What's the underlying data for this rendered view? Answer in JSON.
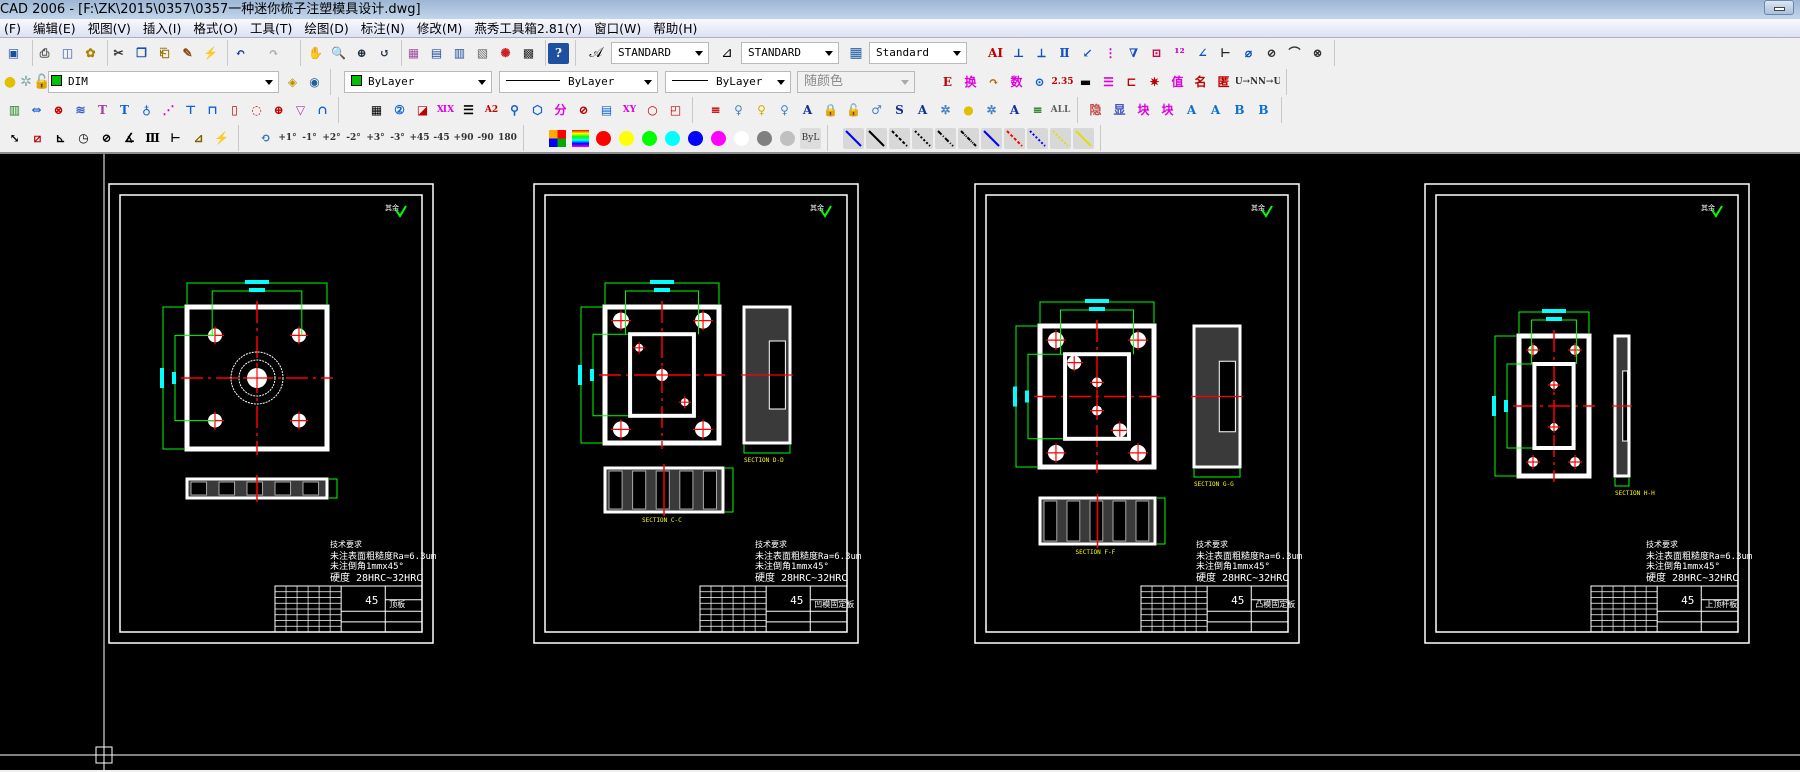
{
  "window": {
    "title": "CAD 2006 - [F:\\ZK\\2015\\0357\\0357一种迷你梳子注塑模具设计.dwg]"
  },
  "menu": [
    "(F)",
    "编辑(E)",
    "视图(V)",
    "插入(I)",
    "格式(O)",
    "工具(T)",
    "绘图(D)",
    "标注(N)",
    "修改(M)",
    "燕秀工具箱2.81(Y)",
    "窗口(W)",
    "帮助(H)"
  ],
  "toolbar_row1": {
    "groups": [
      [
        {
          "name": "save",
          "g": "▣",
          "c": "#1c4fa0"
        }
      ],
      [
        {
          "name": "print",
          "g": "⎙",
          "c": "#555"
        },
        {
          "name": "plot-preview",
          "g": "◫",
          "c": "#3060a0"
        },
        {
          "name": "publish",
          "g": "✿",
          "c": "#b08000"
        }
      ],
      [
        {
          "name": "cut",
          "g": "✂",
          "c": "#333"
        },
        {
          "name": "copy",
          "g": "❐",
          "c": "#2050a0"
        },
        {
          "name": "paste",
          "g": "⎗",
          "c": "#a07000"
        },
        {
          "name": "match-properties",
          "g": "✎",
          "c": "#8b4513"
        },
        {
          "name": "block-editor",
          "g": "⚡",
          "c": "#d05000"
        }
      ],
      [
        {
          "name": "undo",
          "g": "↶",
          "c": "#1a3a8a"
        },
        {
          "name": "redo",
          "g": "↷",
          "c": "#aaa"
        }
      ],
      [
        {
          "name": "pan",
          "g": "✋",
          "c": "#b07050"
        },
        {
          "name": "zoom-realtime",
          "g": "🔍",
          "c": "#234"
        },
        {
          "name": "zoom-window",
          "g": "⊕",
          "c": "#234"
        },
        {
          "name": "zoom-previous",
          "g": "↺",
          "c": "#234"
        }
      ],
      [
        {
          "name": "properties",
          "g": "▦",
          "c": "#a050a0"
        },
        {
          "name": "design-center",
          "g": "▤",
          "c": "#2050a0"
        },
        {
          "name": "tool-palettes",
          "g": "▥",
          "c": "#2050a0"
        },
        {
          "name": "sheet-set",
          "g": "▧",
          "c": "#666"
        },
        {
          "name": "markup",
          "g": "✺",
          "c": "#d02020"
        },
        {
          "name": "quickcalc",
          "g": "▩",
          "c": "#222"
        }
      ],
      [
        {
          "name": "help",
          "g": "?",
          "c": "#fff",
          "bg": "#1f4fa0"
        }
      ],
      [
        {
          "name": "dim-text",
          "g": "AI",
          "c": "#c00000"
        },
        {
          "name": "dim-linear",
          "g": "⊥",
          "c": "#1050c0"
        },
        {
          "name": "dim-ordinate",
          "g": "⟂",
          "c": "#1050c0"
        },
        {
          "name": "dim-baseline",
          "g": "Ⅱ",
          "c": "#1050c0"
        },
        {
          "name": "dim-leader",
          "g": "↙",
          "c": "#1050c0"
        },
        {
          "name": "dim-numbering",
          "g": "⋮",
          "c": "#d000d0"
        },
        {
          "name": "dim-tolerance",
          "g": "∇",
          "c": "#1050c0"
        },
        {
          "name": "dim-coordinate",
          "g": "⊡",
          "c": "#d00050"
        },
        {
          "name": "dim-sequence",
          "g": "¹²",
          "c": "#d000d0"
        },
        {
          "name": "dim-angle",
          "g": "∠",
          "c": "#1050c0"
        },
        {
          "name": "dim-break",
          "g": "⊢",
          "c": "#222"
        },
        {
          "name": "dim-diameter",
          "g": "⌀",
          "c": "#1050c0"
        },
        {
          "name": "dim-radius",
          "g": "⊘",
          "c": "#333"
        },
        {
          "name": "dim-arc",
          "g": "⌒",
          "c": "#333"
        },
        {
          "name": "dim-edit",
          "g": "⊗",
          "c": "#333"
        }
      ]
    ],
    "text_style": "STANDARD",
    "dim_style": "STANDARD",
    "table_style": "Standard"
  },
  "toolbar_row2": {
    "layer": "DIM",
    "color": "ByLayer",
    "linetype": "ByLayer",
    "lineweight": "ByLayer",
    "plot_style": "随颜色",
    "layer_icons": [
      {
        "name": "layer-previous",
        "g": "◈",
        "c": "#c09000"
      },
      {
        "name": "layer-make-current",
        "g": "◉",
        "c": "#2060a0"
      }
    ],
    "icons": [
      {
        "name": "replace-text",
        "g": "E",
        "c": "#c00000"
      },
      {
        "name": "convert",
        "g": "换",
        "c": "#e000e0"
      },
      {
        "name": "arrow-curve",
        "g": "↷",
        "c": "#c06000"
      },
      {
        "name": "numbers",
        "g": "数",
        "c": "#e000e0"
      },
      {
        "name": "snap-circle",
        "g": "⊙",
        "c": "#1060d0"
      },
      {
        "name": "decimal-precision",
        "g": "2.35",
        "c": "#c00000",
        "s": 1
      },
      {
        "name": "layer-strip",
        "g": "▬",
        "c": "#000"
      },
      {
        "name": "color-bars",
        "g": "☰",
        "c": "#e000e0"
      },
      {
        "name": "block-link",
        "g": "⊏",
        "c": "#c00000"
      },
      {
        "name": "explode-text",
        "g": "✷",
        "c": "#c00000"
      },
      {
        "name": "explode-value",
        "g": "值",
        "c": "#e000e0"
      },
      {
        "name": "name-block",
        "g": "名",
        "c": "#c00000"
      },
      {
        "name": "anonymous-block",
        "g": "匿",
        "c": "#c00000"
      },
      {
        "name": "u-to-n",
        "g": "U→N",
        "c": "#333",
        "s": 1
      },
      {
        "name": "n-to-u",
        "g": "N→U",
        "c": "#333",
        "s": 1
      }
    ]
  },
  "toolbar_row3": {
    "groups": [
      [
        {
          "name": "mold-base",
          "g": "▥",
          "c": "#208020"
        },
        {
          "name": "guide-pillar",
          "g": "⇔",
          "c": "#1060d0"
        },
        {
          "name": "sprue",
          "g": "⊗",
          "c": "#c00000"
        },
        {
          "name": "spring",
          "g": "≋",
          "c": "#4060c0"
        },
        {
          "name": "screw",
          "g": "T",
          "c": "#a040a0"
        },
        {
          "name": "ejector-pin",
          "g": "T",
          "c": "#1060d0"
        },
        {
          "name": "ejector-sleeve",
          "g": "♁",
          "c": "#1060d0"
        },
        {
          "name": "cooling",
          "g": "⋰",
          "c": "#d000d0"
        },
        {
          "name": "support-pillar",
          "g": "⊤",
          "c": "#1060d0"
        },
        {
          "name": "stop-pin",
          "g": "⊓",
          "c": "#1060d0"
        },
        {
          "name": "locating-ring",
          "g": "▯",
          "c": "#c00000"
        },
        {
          "name": "gate",
          "g": "◌",
          "c": "#c00000"
        },
        {
          "name": "center-mark",
          "g": "⊕",
          "c": "#c00000"
        },
        {
          "name": "countersunk-screw",
          "g": "▽",
          "c": "#a040a0"
        },
        {
          "name": "slide",
          "g": "∩",
          "c": "#1060d0"
        }
      ],
      [
        {
          "name": "table",
          "g": "▦",
          "c": "#000"
        },
        {
          "name": "balloon",
          "g": "②",
          "c": "#1060d0"
        },
        {
          "name": "view-zoom",
          "g": "◪",
          "c": "#c00000"
        },
        {
          "name": "hole-table",
          "g": "ⅪⅩ",
          "c": "#e000e0",
          "s": 1
        },
        {
          "name": "list",
          "g": "☰",
          "c": "#000"
        },
        {
          "name": "a2-frame",
          "g": "A2",
          "c": "#c00000",
          "s": 1
        },
        {
          "name": "detail-view",
          "g": "⚲",
          "c": "#1060d0"
        },
        {
          "name": "3d-box",
          "g": "⬡",
          "c": "#1060d0"
        },
        {
          "name": "layer-split",
          "g": "分",
          "c": "#e000e0"
        },
        {
          "name": "hide-layer",
          "g": "⊘",
          "c": "#c00000"
        },
        {
          "name": "bom",
          "g": "▤",
          "c": "#1060d0"
        },
        {
          "name": "xy-coordinate",
          "g": "XY",
          "c": "#e000e0",
          "s": 1
        },
        {
          "name": "hole-list",
          "g": "○",
          "c": "#c00000"
        },
        {
          "name": "corner",
          "g": "◰",
          "c": "#c00000"
        }
      ],
      [
        {
          "name": "layer-manager",
          "g": "≡",
          "c": "#c00000"
        },
        {
          "name": "layer-off",
          "g": "♀",
          "c": "#4a80c0"
        },
        {
          "name": "layer-on",
          "g": "♀",
          "c": "#d0b000"
        },
        {
          "name": "layer-isolate",
          "g": "♀",
          "c": "#4a80c0"
        },
        {
          "name": "text-layer-off",
          "g": "A",
          "c": "#1030a0"
        },
        {
          "name": "layer-lock",
          "g": "🔒",
          "c": "#4a80c0"
        },
        {
          "name": "layer-unlock",
          "g": "🔓",
          "c": "#c0a000"
        },
        {
          "name": "layer-walk",
          "g": "♂",
          "c": "#4a80c0"
        },
        {
          "name": "s-layer",
          "g": "S",
          "c": "#1030a0"
        },
        {
          "name": "a-layer",
          "g": "A",
          "c": "#1030a0"
        },
        {
          "name": "layer-freeze",
          "g": "✲",
          "c": "#4a80c0"
        },
        {
          "name": "layer-thaw",
          "g": "●",
          "c": "#e0c000"
        },
        {
          "name": "layer-merge",
          "g": "✲",
          "c": "#4a80c0"
        },
        {
          "name": "a-layer-on",
          "g": "A",
          "c": "#1030a0"
        },
        {
          "name": "layer-stack",
          "g": "≡",
          "c": "#208020"
        },
        {
          "name": "all-dim",
          "g": "ALL",
          "c": "#606060",
          "s": 1
        }
      ],
      [
        {
          "name": "hide",
          "g": "隐",
          "c": "#c05050"
        },
        {
          "name": "show",
          "g": "显",
          "c": "#4050c0"
        },
        {
          "name": "block-hide",
          "g": "块",
          "c": "#e000e0"
        },
        {
          "name": "block-show",
          "g": "块",
          "c": "#e000e0"
        },
        {
          "name": "a-bulb-off",
          "g": "A",
          "c": "#1070d0"
        },
        {
          "name": "a-bulb-on",
          "g": "A",
          "c": "#1070d0"
        },
        {
          "name": "b-bulb-off",
          "g": "B",
          "c": "#1070d0"
        },
        {
          "name": "b-bulb-on",
          "g": "B",
          "c": "#1070d0"
        }
      ]
    ]
  },
  "toolbar_row4": {
    "dim_icons": [
      {
        "name": "dim-aligned",
        "g": "⤡",
        "c": "#000"
      },
      {
        "name": "dim-break-line",
        "g": "⧄",
        "c": "#c00000"
      },
      {
        "name": "dim-ordinate-xy",
        "g": "⊾",
        "c": "#000"
      },
      {
        "name": "dim-radius-circle",
        "g": "◷",
        "c": "#000"
      },
      {
        "name": "dim-diameter-circle",
        "g": "⊘",
        "c": "#000"
      },
      {
        "name": "dim-angular",
        "g": "∡",
        "c": "#000"
      },
      {
        "name": "dim-continue",
        "g": "Ⅲ",
        "c": "#000"
      },
      {
        "name": "dim-space",
        "g": "⊢",
        "c": "#000"
      },
      {
        "name": "dim-oblique",
        "g": "⊿",
        "c": "#806000"
      },
      {
        "name": "dim-text-edit",
        "g": "⚡",
        "c": "#806000"
      }
    ],
    "rotate_icons": [
      {
        "name": "rotate-text",
        "g": "⟲",
        "c": "#4070b0"
      },
      {
        "name": "rotate-plus-1",
        "g": "+1°",
        "c": "#333",
        "s": 1
      },
      {
        "name": "rotate-minus-1",
        "g": "-1°",
        "c": "#333",
        "s": 1
      },
      {
        "name": "rotate-plus-2",
        "g": "+2°",
        "c": "#333",
        "s": 1
      },
      {
        "name": "rotate-minus-2",
        "g": "-2°",
        "c": "#333",
        "s": 1
      },
      {
        "name": "rotate-plus-3",
        "g": "+3°",
        "c": "#333",
        "s": 1
      },
      {
        "name": "rotate-minus-3",
        "g": "-3°",
        "c": "#333",
        "s": 1
      },
      {
        "name": "rotate-plus-45",
        "g": "+45",
        "c": "#333",
        "s": 1
      },
      {
        "name": "rotate-minus-45",
        "g": "-45",
        "c": "#333",
        "s": 1
      },
      {
        "name": "rotate-plus-90",
        "g": "+90",
        "c": "#333",
        "s": 1
      },
      {
        "name": "rotate-minus-90",
        "g": "-90",
        "c": "#333",
        "s": 1
      },
      {
        "name": "rotate-180",
        "g": "180",
        "c": "#333",
        "s": 1
      }
    ],
    "colors": [
      {
        "name": "color-palette",
        "hex": "multi"
      },
      {
        "name": "color-gradient",
        "hex": "gradient"
      },
      {
        "name": "color-red",
        "hex": "#ff0000"
      },
      {
        "name": "color-yellow",
        "hex": "#ffff00"
      },
      {
        "name": "color-green",
        "hex": "#00ff00"
      },
      {
        "name": "color-cyan",
        "hex": "#00ffff"
      },
      {
        "name": "color-blue",
        "hex": "#0000ff"
      },
      {
        "name": "color-magenta",
        "hex": "#ff00ff"
      },
      {
        "name": "color-white",
        "hex": "#ffffff"
      },
      {
        "name": "color-gray",
        "hex": "#808080"
      },
      {
        "name": "color-lightgray",
        "hex": "#c0c0c0"
      }
    ],
    "bylayer_label": "ByL",
    "line_icons": [
      {
        "name": "linetype-dashed-box",
        "hex": "#0000ff"
      },
      {
        "name": "linetype-continuous",
        "hex": "#000000"
      },
      {
        "name": "linetype-dashed",
        "hex": "#000000"
      },
      {
        "name": "linetype-hidden",
        "hex": "#000000"
      },
      {
        "name": "linetype-center",
        "hex": "#000000"
      },
      {
        "name": "linetype-phantom",
        "hex": "#000000"
      },
      {
        "name": "linetype-blue",
        "hex": "#0000ff"
      },
      {
        "name": "linetype-red-dashed",
        "hex": "#ff0000"
      },
      {
        "name": "linetype-blue-dashed",
        "hex": "#0000ff"
      },
      {
        "name": "linetype-yellow-dashed",
        "hex": "#ffff00"
      },
      {
        "name": "linetype-yellow",
        "hex": "#ffff00"
      }
    ]
  },
  "drawing": {
    "colors": {
      "frame": "#ffffff",
      "dimension": "#00ff00",
      "centerline": "#ff0000",
      "dim_text": "#00ffff",
      "hidden": "#ffff00"
    },
    "roughness_note": "其余",
    "sheets": [
      {
        "notes_title": "技术要求",
        "notes": [
          "未注表面粗糙度Ra=6.3um",
          "未注倒角1mmx45°",
          "硬度 28HRC~32HRC"
        ],
        "material": "45",
        "part_name": "顶板",
        "section_labels": []
      },
      {
        "notes_title": "技术要求",
        "notes": [
          "未注表面粗糙度Ra=6.3um",
          "未注倒角1mmx45°",
          "硬度 28HRC~32HRC"
        ],
        "material": "45",
        "part_name": "凹模固定板",
        "section_labels": [
          "SECTION D-D",
          "SECTION C-C"
        ]
      },
      {
        "notes_title": "技术要求",
        "notes": [
          "未注表面粗糙度Ra=6.3um",
          "未注倒角1mmx45°",
          "硬度 28HRC~32HRC"
        ],
        "material": "45",
        "part_name": "凸模固定板",
        "section_labels": [
          "SECTION G-G",
          "SECTION F-F"
        ]
      },
      {
        "notes_title": "技术要求",
        "notes": [
          "未注表面粗糙度Ra=6.3um",
          "未注倒角1mmx45°",
          "硬度 28HRC~32HRC"
        ],
        "material": "45",
        "part_name": "上顶杆板",
        "section_labels": [
          "SECTION H-H"
        ]
      }
    ]
  }
}
